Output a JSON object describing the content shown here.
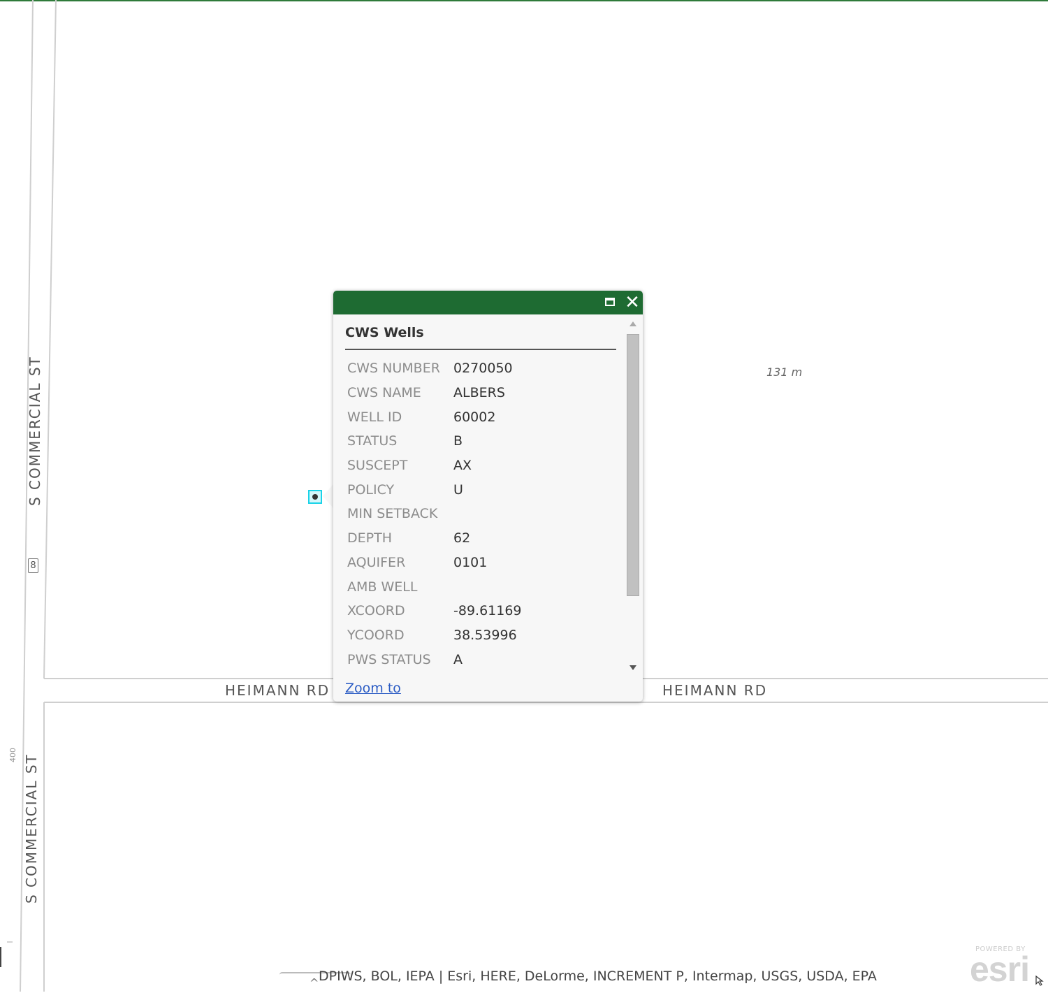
{
  "map": {
    "roads": {
      "vertical_upper": "S  COMMERCIAL  ST",
      "vertical_lower": "S  COMMERCIAL  ST",
      "horizontal_left": "HEIMANN  RD",
      "horizontal_right": "HEIMANN  RD"
    },
    "route_shield": "8",
    "scale_note": "131 m",
    "side_tick_label": "400",
    "selection_color": "#1ad3e8"
  },
  "popup": {
    "header_color": "#1e6b32",
    "maximize_icon": "maximize-icon",
    "close_glyph": "✕",
    "layer_title": "CWS Wells",
    "fields": [
      {
        "key": "CWS NUMBER",
        "value": "0270050"
      },
      {
        "key": "CWS NAME",
        "value": "ALBERS"
      },
      {
        "key": "WELL ID",
        "value": "60002"
      },
      {
        "key": "STATUS",
        "value": "B"
      },
      {
        "key": "SUSCEPT",
        "value": "AX"
      },
      {
        "key": "POLICY",
        "value": "U"
      },
      {
        "key": "MIN SETBACK",
        "value": ""
      },
      {
        "key": "DEPTH",
        "value": "62"
      },
      {
        "key": "AQUIFER",
        "value": "0101"
      },
      {
        "key": "AMB WELL",
        "value": ""
      },
      {
        "key": "XCOORD",
        "value": "-89.61169"
      },
      {
        "key": "YCOORD",
        "value": "38.53996"
      },
      {
        "key": "PWS STATUS",
        "value": "A"
      }
    ],
    "zoom_link": "Zoom to"
  },
  "footer": {
    "attribution": "DPIWS, BOL, IEPA | Esri, HERE, DeLorme, INCREMENT P, Intermap, USGS, USDA, EPA",
    "toggle_glyph": "^",
    "logo_powered": "POWERED BY",
    "logo_word": "esri"
  }
}
